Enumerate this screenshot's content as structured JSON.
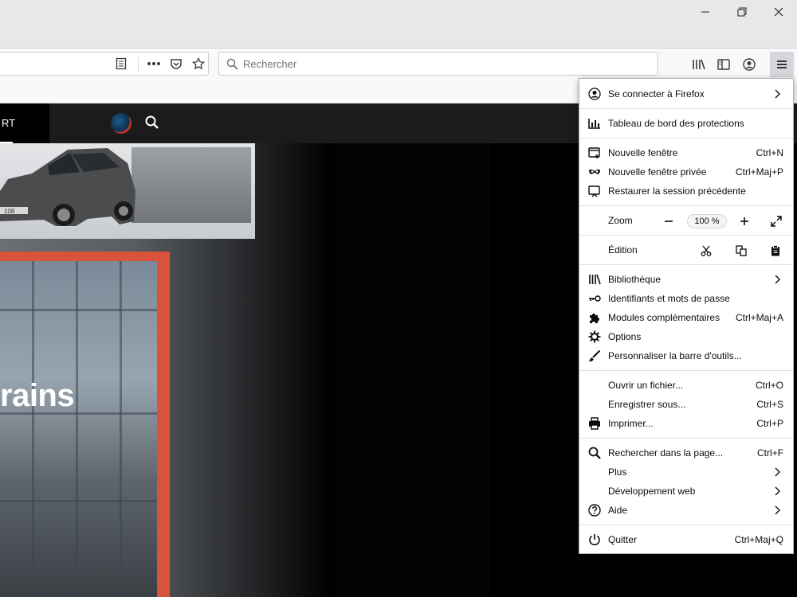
{
  "browser": {
    "search_placeholder": "Rechercher"
  },
  "site": {
    "nav_tab_label": "RT",
    "hero_word": "rains",
    "car_badge": "108"
  },
  "appmenu": {
    "sign_in": "Se connecter à Firefox",
    "protections": "Tableau de bord des protections",
    "new_window": {
      "label": "Nouvelle fenêtre",
      "shortcut": "Ctrl+N"
    },
    "private_window": {
      "label": "Nouvelle fenêtre privée",
      "shortcut": "Ctrl+Maj+P"
    },
    "restore_session": "Restaurer la session précédente",
    "zoom": {
      "label": "Zoom",
      "level": "100 %"
    },
    "edit": {
      "label": "Édition"
    },
    "library": "Bibliothèque",
    "logins": "Identifiants et mots de passe",
    "addons": {
      "label": "Modules complémentaires",
      "shortcut": "Ctrl+Maj+A"
    },
    "options": "Options",
    "customize": "Personnaliser la barre d'outils...",
    "open_file": {
      "label": "Ouvrir un fichier...",
      "shortcut": "Ctrl+O"
    },
    "save_as": {
      "label": "Enregistrer sous...",
      "shortcut": "Ctrl+S"
    },
    "print": {
      "label": "Imprimer...",
      "shortcut": "Ctrl+P"
    },
    "find": {
      "label": "Rechercher dans la page...",
      "shortcut": "Ctrl+F"
    },
    "more": "Plus",
    "web_dev": "Développement web",
    "help": "Aide",
    "quit": {
      "label": "Quitter",
      "shortcut": "Ctrl+Maj+Q"
    }
  },
  "colors": {
    "menu_bg": "#ffffff",
    "titlebar_bg": "#e8e8eb",
    "accent_red": "#d9533c"
  },
  "icons": [
    "minimize-icon",
    "restore-icon",
    "close-icon",
    "reader-view-icon",
    "page-actions-icon",
    "pocket-icon",
    "bookmark-star-icon",
    "search-icon",
    "library-icon",
    "sidebar-icon",
    "account-icon",
    "hamburger-menu-icon"
  ]
}
